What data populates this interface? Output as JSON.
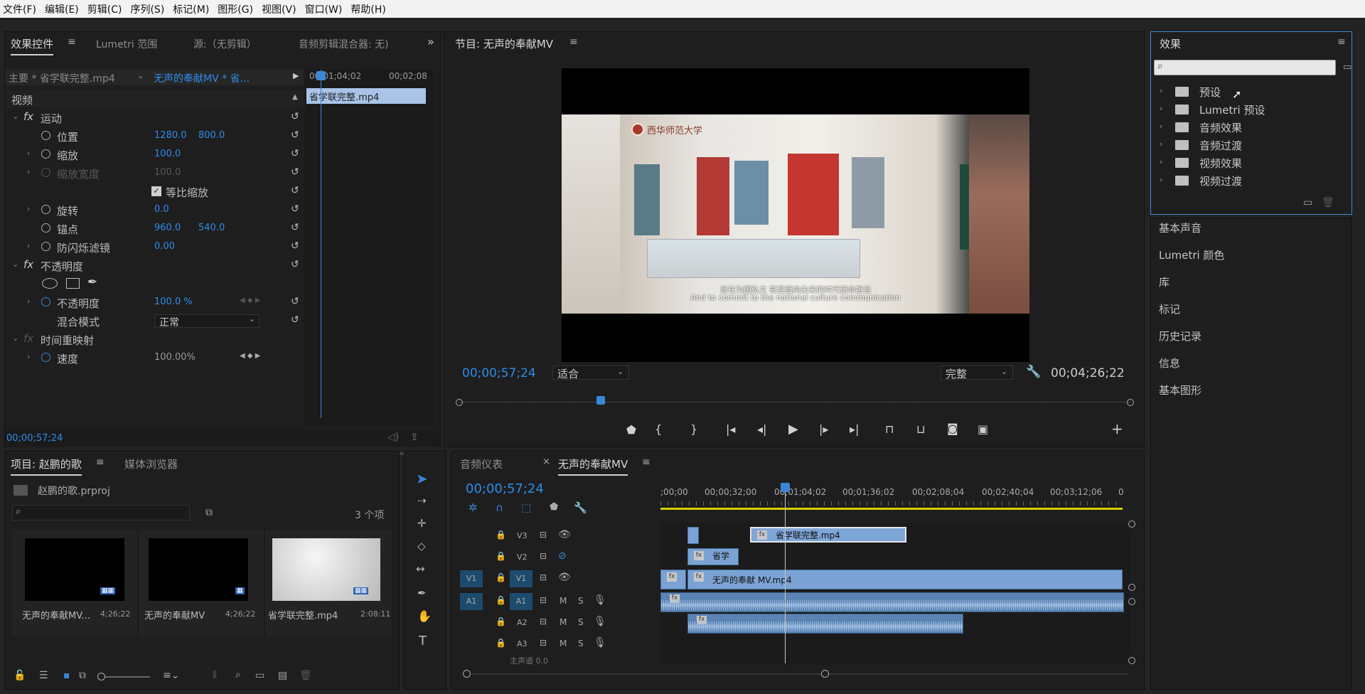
{
  "menu": [
    "文件(F)",
    "编辑(E)",
    "剪辑(C)",
    "序列(S)",
    "标记(M)",
    "图形(G)",
    "视图(V)",
    "窗口(W)",
    "帮助(H)"
  ],
  "effect_controls": {
    "tabs": [
      "效果控件",
      "Lumetri 范围",
      "源:（无剪辑）",
      "音频剪辑混合器: 无)"
    ],
    "master": "主要 * 省学联完整.mp4",
    "sequence": "无声的奉献MV * 省...",
    "ruler": [
      "00;01;04;02",
      "00;02;08"
    ],
    "clip_label": "省学联完整.mp4",
    "video_header": "视频",
    "motion": "运动",
    "position": {
      "label": "位置",
      "x": "1280.0",
      "y": "800.0"
    },
    "scale": {
      "label": "缩放",
      "value": "100.0"
    },
    "scale_width": {
      "label": "缩放宽度",
      "value": "100.0"
    },
    "uniform": "等比缩放",
    "rotation": {
      "label": "旋转",
      "value": "0.0"
    },
    "anchor": {
      "label": "锚点",
      "x": "960.0",
      "y": "540.0"
    },
    "antiflicker": {
      "label": "防闪烁滤镜",
      "value": "0.00"
    },
    "opacity_header": "不透明度",
    "opacity": {
      "label": "不透明度",
      "value": "100.0 %"
    },
    "blend": {
      "label": "混合模式",
      "value": "正常"
    },
    "time_remap": "时间重映射",
    "speed": {
      "label": "速度",
      "value": "100.00%"
    },
    "timecode": "00;00;57;24"
  },
  "program": {
    "title": "节目: 无声的奉献MV",
    "sub_cn": "旨在为国弘文 彰显面向未来的时代使命担当",
    "sub_en": "And to commit to the national culture communication",
    "logo_text": "西华师范大学",
    "timecode": "00;00;57;24",
    "fit": "适合",
    "quality": "完整",
    "duration": "00;04;26;22"
  },
  "project": {
    "tabs": [
      "项目: 赵鹏的歌",
      "媒体浏览器"
    ],
    "file": "赵鹏的歌.prproj",
    "count": "3 个项",
    "items": [
      {
        "name": "无声的奉献MV...",
        "dur": "4;26;22"
      },
      {
        "name": "无声的奉献MV",
        "dur": "4;26;22"
      },
      {
        "name": "省学联完整.mp4",
        "dur": "2:08:11"
      }
    ]
  },
  "timeline": {
    "tabs": [
      "音频仪表",
      "无声的奉献MV"
    ],
    "timecode": "00;00;57;24",
    "ruler": [
      ";00;00",
      "00;00;32;00",
      "00;01;04;02",
      "00;01;36;02",
      "00;02;08;04",
      "00;02;40;04",
      "00;03;12;06",
      "0"
    ],
    "tracks": {
      "v3": "V3",
      "v2": "V2",
      "v1": "V1",
      "a1": "A1",
      "a2": "A2",
      "a3": "A3"
    },
    "src_v": "V1",
    "src_a": "A1",
    "mute": "M",
    "solo": "S",
    "clips": {
      "v3": "省学联完整.mp4",
      "v2": "省学",
      "v1": "无声的奉献 MV.mp4"
    },
    "master": "主声道 0.0"
  },
  "effects": {
    "title": "效果",
    "search_placeholder": "",
    "items": [
      "预设",
      "Lumetri 预设",
      "音频效果",
      "音频过渡",
      "视频效果",
      "视频过渡"
    ]
  },
  "side_panels": [
    "基本声音",
    "Lumetri 颜色",
    "库",
    "标记",
    "历史记录",
    "信息",
    "基本图形"
  ]
}
